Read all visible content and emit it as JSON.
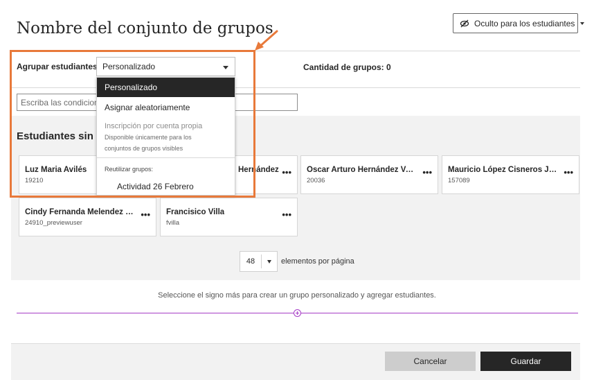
{
  "header": {
    "title": "Nombre del conjunto de grupos",
    "visibility_label": "Oculto para los estudiantes"
  },
  "grouping": {
    "label": "Agrupar estudiantes",
    "selected": "Personalizado",
    "group_count_label": "Cantidad de grupos: 0"
  },
  "conditions": {
    "placeholder": "Escriba las condiciones"
  },
  "dropdown": {
    "options": [
      {
        "label": "Personalizado",
        "selected": true
      },
      {
        "label": "Asignar aleatoriamente",
        "selected": false
      },
      {
        "label": "Inscripción por cuenta propia",
        "disabled": true
      }
    ],
    "self_enroll_note_line1": "Disponible únicamente para los",
    "self_enroll_note_line2": "conjuntos de grupos visibles",
    "reuse_label": "Reutilizar grupos:",
    "reuse_item": "Actividad 26 Febrero"
  },
  "unassigned": {
    "title": "Estudiantes sin as",
    "students": [
      {
        "name": "Luz Maria Avilés",
        "id": "19210"
      },
      {
        "name": "Hernández",
        "id": ""
      },
      {
        "name": "Oscar Arturo Hernández Vazq...",
        "id": "20036"
      },
      {
        "name": "Mauricio López Cisneros Jimé...",
        "id": "157089"
      },
      {
        "name": "Cindy Fernanda Melendez Ruí...",
        "id": "24910_previewuser"
      },
      {
        "name": "Francisico Villa",
        "id": "fvilla"
      }
    ],
    "more_label": "•••"
  },
  "pager": {
    "value": "48",
    "caret": "▼",
    "label": "elementos por página"
  },
  "hint": "Seleccione el signo más para crear un grupo personalizado y agregar estudiantes.",
  "footer": {
    "cancel": "Cancelar",
    "save": "Guardar"
  },
  "colors": {
    "highlight": "#e8793a",
    "accent_purple": "#a53bc6",
    "dark": "#262626"
  }
}
